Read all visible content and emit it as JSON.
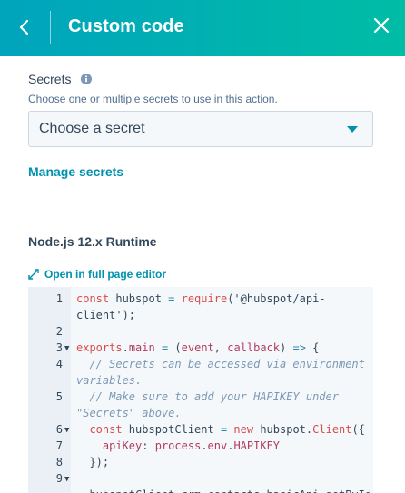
{
  "header": {
    "title": "Custom code"
  },
  "secrets": {
    "label": "Secrets",
    "help_text": "Choose one or multiple secrets to use in this action.",
    "select_value": "Choose a secret",
    "manage_link": "Manage secrets"
  },
  "runtime": {
    "label": "Node.js 12.x Runtime",
    "open_editor_link": "Open in full page editor"
  },
  "editor": {
    "lines": [
      {
        "n": "1",
        "text": "const hubspot = require('@hubspot/api-",
        "fold": ""
      },
      {
        "n": "",
        "text": "client');",
        "fold": ""
      },
      {
        "n": "2",
        "text": "",
        "fold": ""
      },
      {
        "n": "3",
        "text": "exports.main = (event, callback) => {",
        "fold": "▼"
      },
      {
        "n": "4",
        "text": "  // Secrets can be accessed via environment",
        "fold": ""
      },
      {
        "n": "",
        "text": "variables.",
        "fold": ""
      },
      {
        "n": "5",
        "text": "  // Make sure to add your HAPIKEY under",
        "fold": ""
      },
      {
        "n": "",
        "text": "\"Secrets\" above.",
        "fold": ""
      },
      {
        "n": "6",
        "text": "  const hubspotClient = new hubspot.Client({",
        "fold": "▼"
      },
      {
        "n": "7",
        "text": "    apiKey: process.env.HAPIKEY",
        "fold": ""
      },
      {
        "n": "8",
        "text": "  });",
        "fold": ""
      },
      {
        "n": "9",
        "text": "",
        "fold": "▼"
      },
      {
        "n": "",
        "text": "  hubspotClient.crm.contacts.basicApi.getById",
        "fold": ""
      }
    ]
  }
}
